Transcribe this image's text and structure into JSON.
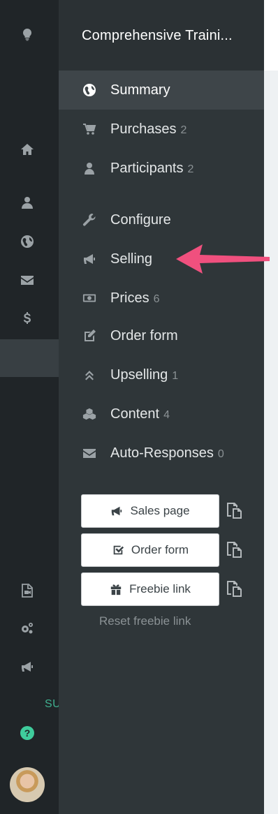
{
  "rail": {
    "icons": [
      "lightbulb-icon",
      "home-icon",
      "user-icon",
      "globe-icon",
      "envelope-icon",
      "dollar-icon",
      "video-file-icon",
      "gears-icon",
      "megaphone-icon"
    ],
    "support_label": "SU",
    "help_glyph": "?"
  },
  "panel": {
    "title": "Comprehensive Traini..."
  },
  "nav": {
    "items": [
      {
        "label": "Summary",
        "count": "",
        "icon": "globe-icon",
        "active": true
      },
      {
        "label": "Purchases",
        "count": "2",
        "icon": "cart-icon"
      },
      {
        "label": "Participants",
        "count": "2",
        "icon": "user-icon"
      },
      {
        "label": "Configure",
        "count": "",
        "icon": "wrench-icon"
      },
      {
        "label": "Selling",
        "count": "",
        "icon": "megaphone-icon"
      },
      {
        "label": "Prices",
        "count": "6",
        "icon": "money-icon"
      },
      {
        "label": "Order form",
        "count": "",
        "icon": "edit-icon"
      },
      {
        "label": "Upselling",
        "count": "1",
        "icon": "double-chevron-up-icon"
      },
      {
        "label": "Content",
        "count": "4",
        "icon": "cubes-icon"
      },
      {
        "label": "Auto-Responses",
        "count": "0",
        "icon": "envelope-icon"
      }
    ]
  },
  "links": {
    "sales_page": "Sales page",
    "order_form": "Order form",
    "freebie_link": "Freebie link",
    "reset_freebie": "Reset freebie link"
  },
  "colors": {
    "rail_bg": "#202528",
    "panel_bg": "#2f3639",
    "active_bg": "#3e4549",
    "accent_green": "#3fcc9c",
    "annotation_pink": "#f0507e"
  }
}
